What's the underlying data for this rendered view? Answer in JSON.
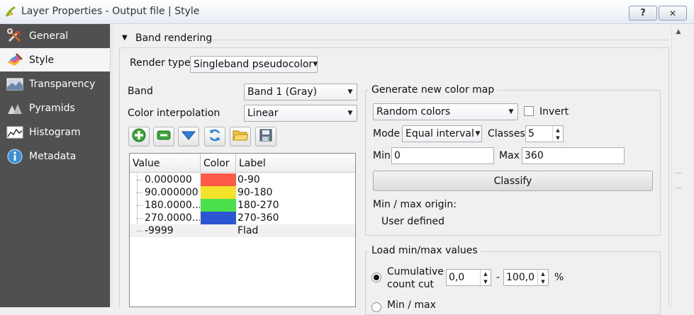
{
  "window": {
    "title": "Layer Properties - Output file | Style",
    "help_label": "?",
    "close_label": "✕"
  },
  "sidebar": {
    "items": [
      {
        "label": "General",
        "icon": "tools-icon"
      },
      {
        "label": "Style",
        "icon": "paint-brush-icon",
        "active": true
      },
      {
        "label": "Transparency",
        "icon": "transparency-icon"
      },
      {
        "label": "Pyramids",
        "icon": "pyramids-icon"
      },
      {
        "label": "Histogram",
        "icon": "histogram-icon"
      },
      {
        "label": "Metadata",
        "icon": "info-icon"
      }
    ]
  },
  "band_rendering": {
    "section_title": "Band rendering",
    "render_type_label": "Render type",
    "render_type_value": "Singleband pseudocolor",
    "band_label": "Band",
    "band_value": "Band 1 (Gray)",
    "interp_label": "Color interpolation",
    "interp_value": "Linear"
  },
  "toolbar": {
    "buttons": [
      "add-icon",
      "remove-icon",
      "sort-icon",
      "refresh-icon",
      "open-folder-icon",
      "save-icon"
    ]
  },
  "color_table": {
    "headers": [
      "Value",
      "Color",
      "Label"
    ],
    "rows": [
      {
        "value": "0.000000",
        "color": "#ff5a47",
        "label": "0-90"
      },
      {
        "value": "90.000000",
        "color": "#f2e22a",
        "label": "90-180"
      },
      {
        "value": "180.0000...",
        "color": "#4ae04c",
        "label": "180-270"
      },
      {
        "value": "270.0000...",
        "color": "#2a56d4",
        "label": "270-360"
      },
      {
        "value": "-9999",
        "color": "",
        "label": "Flad"
      }
    ]
  },
  "generate": {
    "title": "Generate new color map",
    "ramp_value": "Random colors",
    "invert_label": "Invert",
    "mode_label": "Mode",
    "mode_value": "Equal interval",
    "classes_label": "Classes",
    "classes_value": "5",
    "min_label": "Min",
    "min_value": "0",
    "max_label": "Max",
    "max_value": "360",
    "classify_label": "Classify",
    "origin_label": "Min / max origin:",
    "origin_value": "User defined"
  },
  "load_minmax": {
    "title": "Load min/max values",
    "cumulative_label_1": "Cumulative",
    "cumulative_label_2": "count cut",
    "from_value": "0,0",
    "dash": "-",
    "to_value": "100,0",
    "percent": "%",
    "minmax_label": "Min / max"
  }
}
